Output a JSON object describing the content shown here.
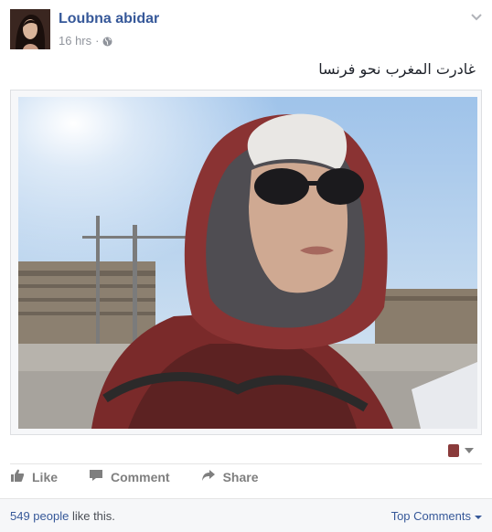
{
  "post": {
    "author": "Loubna abidar",
    "timestamp": "16 hrs",
    "meta_separator": "·",
    "privacy_icon": "globe-icon",
    "status_text": "غادرت المغرب نحو فرنسا",
    "menu_icon": "chevron-down-icon"
  },
  "photo": {
    "tag_icon": "tag-thumb-icon",
    "tag_menu_icon": "caret-down-icon"
  },
  "actions": {
    "like_label": "Like",
    "comment_label": "Comment",
    "share_label": "Share"
  },
  "likes": {
    "count_text": "549 people",
    "suffix_text": " like this.",
    "top_comments_label": "Top Comments"
  },
  "colors": {
    "link": "#365899",
    "muted": "#90949c",
    "action": "#7f7f7f"
  }
}
